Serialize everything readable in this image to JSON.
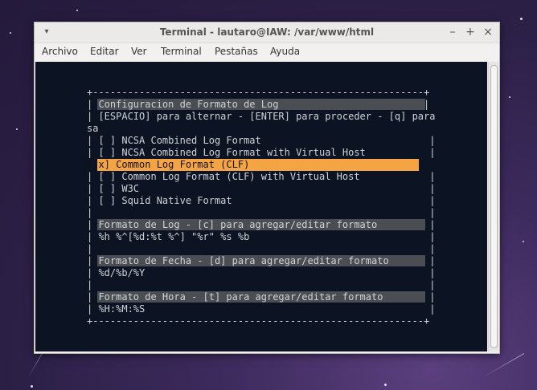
{
  "window": {
    "title": "Terminal - lautaro@IAW: /var/www/html",
    "controls": {
      "minimize": "–",
      "maximize": "+",
      "close": "×"
    }
  },
  "menubar": [
    "Archivo",
    "Editar",
    "Ver",
    "Terminal",
    "Pestañas",
    "Ayuda"
  ],
  "terminal": {
    "border_top": "+---------------------------------------------------------+",
    "border_bottom": "+---------------------------------------------------------+",
    "rows": [
      "| Configuracion de Formato de Log                         |",
      "| [ESPACIO] para alternar - [ENTER] para proceder - [q] para",
      "sa",
      "| [ ] NCSA Combined Log Format                             |",
      "| [ ] NCSA Combined Log Format with Virtual Host           |",
      "|[x] Common Log Format (CLF)",
      "| [ ] Common Log Format (CLF) with Virtual Host            |",
      "| [ ] W3C                                                  |",
      "| [ ] Squid Native Format                                  |",
      "|                                                          |",
      "| Formato de Log - [c] para agregar/editar formato         |",
      "| %h %^[%d:%t %^] \"%r\" %s %b                               |",
      "|                                                          |",
      "| Formato de Fecha - [d] para agregar/editar formato       |",
      "| %d/%b/%Y                                                 |",
      "|                                                          |",
      "| Formato de Hora - [t] para agregar/editar formato        |",
      "| %H:%M:%S                                                 |"
    ]
  }
}
